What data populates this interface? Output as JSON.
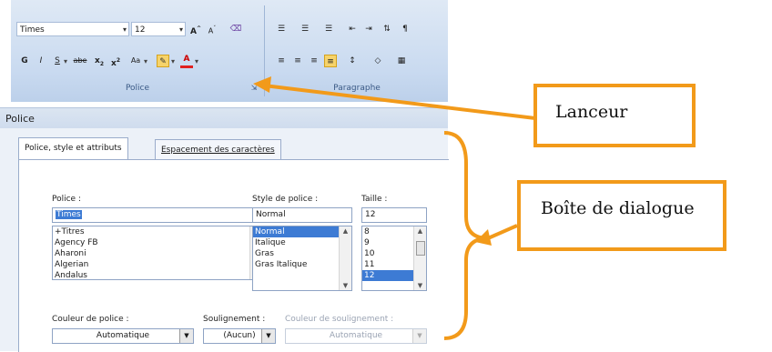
{
  "ribbon": {
    "font_name": "Times",
    "font_size": "12",
    "grow_font": "A",
    "shrink_font": "A",
    "bold": "G",
    "italic": "I",
    "underline": "S",
    "strike": "abe",
    "subscript": "x",
    "superscript": "x",
    "case": "Aa",
    "font_color": "A",
    "group_police": "Police",
    "group_paragraphe": "Paragraphe"
  },
  "dialog": {
    "title": "Police",
    "tabs": [
      {
        "label": "Police, style et attributs"
      },
      {
        "label": "Espacement des caractères"
      }
    ],
    "font_label": "Police :",
    "font_value": "Times",
    "font_list": [
      "+Titres",
      "Agency FB",
      "Aharoni",
      "Algerian",
      "Andalus"
    ],
    "style_label": "Style de police :",
    "style_value": "Normal",
    "style_list": [
      "Normal",
      "Italique",
      "Gras",
      "Gras Italique"
    ],
    "style_selected": "Normal",
    "size_label": "Taille :",
    "size_value": "12",
    "size_list": [
      "8",
      "9",
      "10",
      "11",
      "12"
    ],
    "size_selected": "12",
    "font_color_label": "Couleur de police :",
    "font_color_value": "Automatique",
    "underline_label": "Soulignement :",
    "underline_value": "(Aucun)",
    "underline_color_label": "Couleur de soulignement :",
    "underline_color_value": "Automatique"
  },
  "annotations": {
    "lanceur": "Lanceur",
    "boite": "Boîte de dialogue"
  },
  "colors": {
    "annotation_orange": "#f29a1a",
    "selection_blue": "#3d7bd4",
    "highlight_yellow": "#f6d36a",
    "font_color_red": "#e02020"
  }
}
